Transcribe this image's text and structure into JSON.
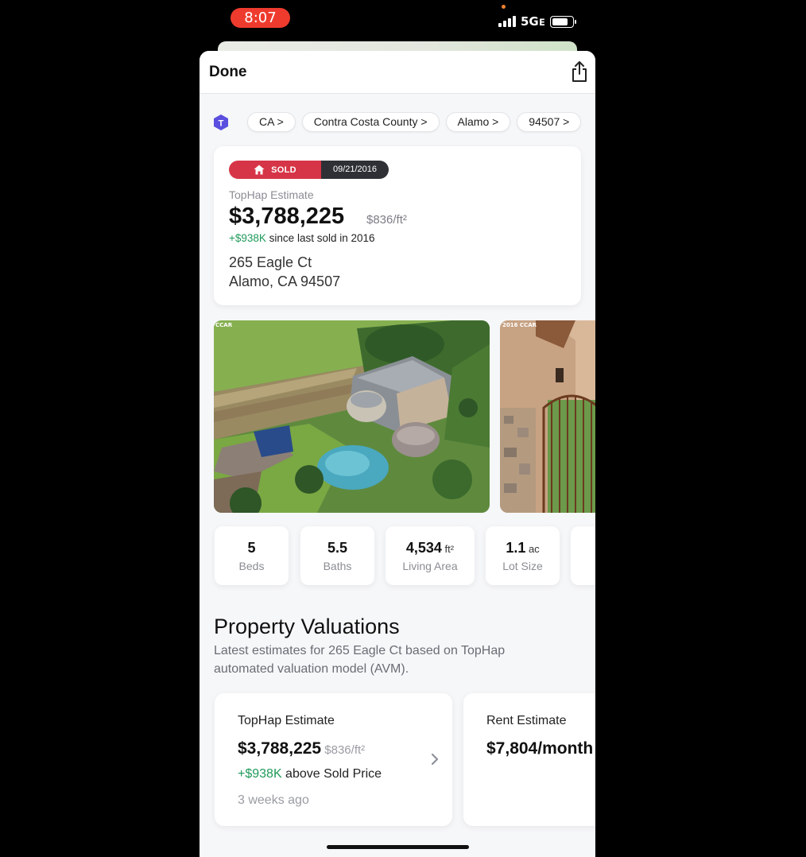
{
  "status_bar": {
    "time": "8:07",
    "network": "5Gᴇ"
  },
  "topbar": {
    "done_label": "Done",
    "share_icon": "share-icon"
  },
  "breadcrumbs": {
    "brand_icon": "tophap-logo-icon",
    "items": [
      {
        "label": "CA >"
      },
      {
        "label": "Contra Costa County >"
      },
      {
        "label": "Alamo >"
      },
      {
        "label": "94507 >"
      }
    ]
  },
  "estimate_card": {
    "status": "SOLD",
    "sold_date": "09/21/2016",
    "estimate_label": "TopHap Estimate",
    "price": "$3,788,225",
    "price_per_sqft": "$836/ft²",
    "change": "+$938K",
    "change_suffix": " since last sold in 2016",
    "address_line1": "265 Eagle Ct",
    "address_line2": "Alamo, CA 94507"
  },
  "photos": {
    "main_tag": "CCAR",
    "second_tag": "2016 CCAR"
  },
  "stats": [
    {
      "value": "5",
      "unit": "",
      "label": "Beds"
    },
    {
      "value": "5.5",
      "unit": "",
      "label": "Baths"
    },
    {
      "value": "4,534",
      "unit": " ft²",
      "label": "Living Area"
    },
    {
      "value": "1.1",
      "unit": " ac",
      "label": "Lot Size"
    }
  ],
  "valuations": {
    "title": "Property Valuations",
    "description": "Latest estimates for 265 Eagle Ct based on TopHap automated valuation model (AVM).",
    "cards": [
      {
        "title": "TopHap Estimate",
        "price": "$3,788,225",
        "price_per_sqft": " $836/ft²",
        "change": "+$938K",
        "change_suffix": " above Sold Price",
        "time": "3 weeks ago"
      },
      {
        "title": "Rent Estimate",
        "price": "$7,804/month"
      }
    ]
  },
  "colors": {
    "sold": "#d63547",
    "positive": "#1f9a5a",
    "brand": "#5b4fe0"
  }
}
